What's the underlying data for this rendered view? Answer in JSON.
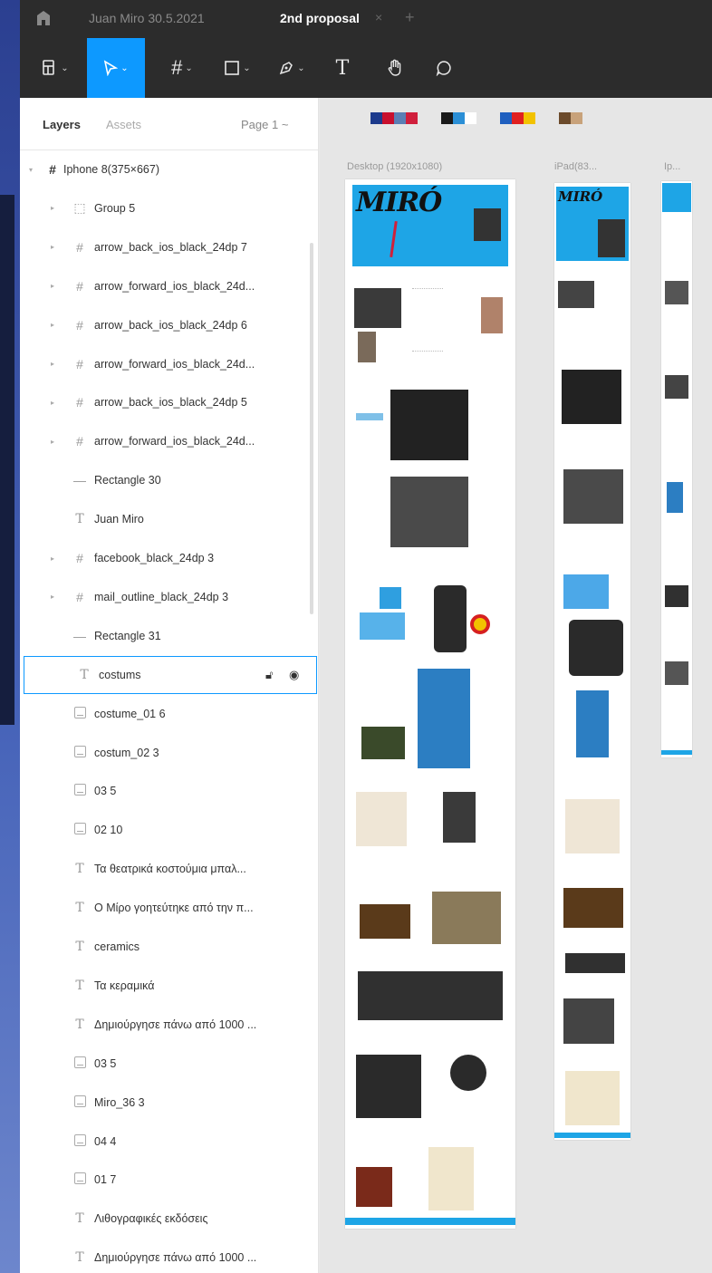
{
  "titlebar": {
    "file_name": "Juan Miro 30.5.2021",
    "active_tab": "2nd proposal",
    "close_symbol": "×",
    "add_symbol": "+"
  },
  "toolbar": {
    "tools": [
      {
        "name": "main-menu",
        "icon": "figma-menu-icon",
        "active": false
      },
      {
        "name": "move",
        "icon": "move-cursor-icon",
        "active": true
      },
      {
        "name": "frame",
        "icon": "frame-hash-icon",
        "active": false
      },
      {
        "name": "shape",
        "icon": "rectangle-icon",
        "active": false
      },
      {
        "name": "pen",
        "icon": "pen-icon",
        "active": false
      },
      {
        "name": "text",
        "icon": "text-icon",
        "active": false
      },
      {
        "name": "hand",
        "icon": "hand-icon",
        "active": false
      },
      {
        "name": "comment",
        "icon": "comment-icon",
        "active": false
      }
    ],
    "text_glyph": "T"
  },
  "panel": {
    "tab_layers": "Layers",
    "tab_assets": "Assets",
    "page_selector": "Page 1 ~"
  },
  "layers": [
    {
      "label": "Iphone 8(375×667)",
      "type": "frame",
      "expanded": true
    },
    {
      "label": "Group 5",
      "type": "group"
    },
    {
      "label": "arrow_back_ios_black_24dp 7",
      "type": "frame"
    },
    {
      "label": "arrow_forward_ios_black_24d...",
      "type": "frame"
    },
    {
      "label": "arrow_back_ios_black_24dp 6",
      "type": "frame"
    },
    {
      "label": "arrow_forward_ios_black_24d...",
      "type": "frame"
    },
    {
      "label": "arrow_back_ios_black_24dp 5",
      "type": "frame"
    },
    {
      "label": "arrow_forward_ios_black_24d...",
      "type": "frame"
    },
    {
      "label": "Rectangle 30",
      "type": "line"
    },
    {
      "label": "Juan Miro",
      "type": "text"
    },
    {
      "label": "facebook_black_24dp 3",
      "type": "frame"
    },
    {
      "label": "mail_outline_black_24dp 3",
      "type": "frame"
    },
    {
      "label": "Rectangle 31",
      "type": "line"
    },
    {
      "label": "costums",
      "type": "text",
      "selected": true
    },
    {
      "label": "costume_01 6",
      "type": "image"
    },
    {
      "label": "costum_02 3",
      "type": "image"
    },
    {
      "label": "03 5",
      "type": "image"
    },
    {
      "label": "02 10",
      "type": "image"
    },
    {
      "label": "Τα θεατρικά κοστούμια μπαλ...",
      "type": "text"
    },
    {
      "label": "Ο Μίρο γοητεύτηκε από την π...",
      "type": "text"
    },
    {
      "label": "ceramics",
      "type": "text"
    },
    {
      "label": "Τα κεραμικά",
      "type": "text"
    },
    {
      "label": "Δημιούργησε πάνω από 1000 ...",
      "type": "text"
    },
    {
      "label": "03 5",
      "type": "image"
    },
    {
      "label": "Miro_36 3",
      "type": "image"
    },
    {
      "label": "04 4",
      "type": "image"
    },
    {
      "label": "01 7",
      "type": "image"
    },
    {
      "label": "Λιθογραφικές εκδόσεις",
      "type": "text"
    },
    {
      "label": "Δημιούργησε πάνω από 1000 ...",
      "type": "text"
    }
  ],
  "canvas": {
    "frame_labels": [
      "Desktop (1920x1080)",
      "iPad(83...",
      "Ip..."
    ],
    "logo_text": "MIRÓ",
    "palette": [
      "#1c3a8c",
      "#c8102e",
      "#5b7fb5",
      "#d01f3c",
      "#1a1a1a",
      "#2b8fd6",
      "#ffffff",
      "#1f5fbf",
      "#e02020",
      "#f2c200",
      "#6b4a2b",
      "#c8a27a"
    ],
    "accent_blue": "#1ea5e6",
    "selection_blue": "#0d99ff"
  }
}
